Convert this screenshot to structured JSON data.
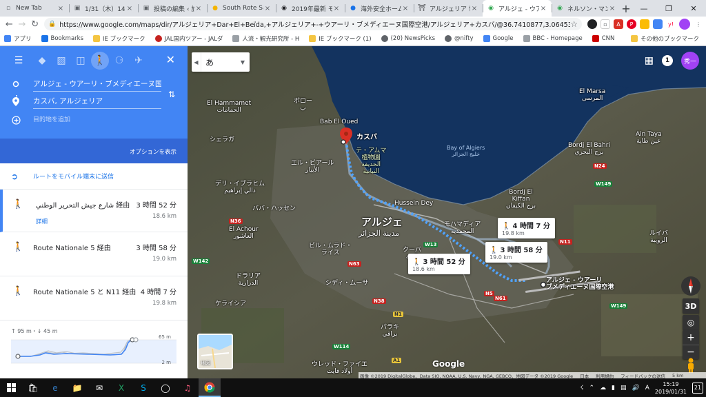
{
  "browser": {
    "tabs": [
      {
        "title": "New Tab",
        "icon": "newtab-icon",
        "color": "#5f6368"
      },
      {
        "title": "1/31（木）14時",
        "icon": "doc-icon",
        "color": "#5f6368"
      },
      {
        "title": "投稿の編集 ‹ 旅行",
        "icon": "doc-icon",
        "color": "#5f6368"
      },
      {
        "title": "South Rote Sa",
        "icon": "site-icon",
        "color": "#f4b400"
      },
      {
        "title": "2019年最新 モ",
        "icon": "tripadvisor-icon",
        "color": "#202124"
      },
      {
        "title": "海外安全ホーム",
        "icon": "site-icon",
        "color": "#1a73e8"
      },
      {
        "title": "アルジェリア 世界",
        "icon": "museum-icon",
        "color": "#202124"
      },
      {
        "title": "アルジェ - ウアーリ",
        "icon": "maps-icon",
        "color": "#34a853"
      },
      {
        "title": "ネルソン・マンデ",
        "icon": "maps-icon",
        "color": "#34a853"
      }
    ],
    "active_tab": 7,
    "url": "https://www.google.com/maps/dir/アルジェリア+Dar+El+Beïda,+アルジェリア+-+ウアーリ・ブメディエーヌ国際空港/アルジェリア+カスバ/@36.7410877,3.0645346,22097m/data=!3m1!1e3!4m14!...",
    "bookmarks": [
      {
        "label": "アプリ",
        "icon": "apps-icon"
      },
      {
        "label": "Bookmarks",
        "icon": "star-icon"
      },
      {
        "label": "IE ブックマーク",
        "icon": "folder-icon"
      },
      {
        "label": "JAL国内ツアー - JALダ",
        "icon": "jal-icon"
      },
      {
        "label": "人流・観光研究所 - H",
        "icon": "doc-icon"
      },
      {
        "label": "IE ブックマーク (1)",
        "icon": "folder-icon"
      },
      {
        "label": "(20) NewsPicks",
        "icon": "site-icon"
      },
      {
        "label": "@nifty",
        "icon": "site-icon"
      },
      {
        "label": "Google",
        "icon": "google-icon"
      },
      {
        "label": "BBC - Homepage",
        "icon": "doc-icon"
      },
      {
        "label": "CNN",
        "icon": "cnn-icon"
      }
    ],
    "other_bookmarks": "その他のブックマーク"
  },
  "panel": {
    "origin": "アルジェ - ウアーリ・ブメディエーヌ国",
    "destination": "カスバ, アルジェリア",
    "add_destination": "目的地を追加",
    "options": "オプションを表示",
    "send_to_phone": "ルートをモバイル端末に送信",
    "routes": [
      {
        "via": "شارع جيش التحرير الوطني 経由",
        "time": "3 時間 52 分",
        "distance": "18.6 km",
        "details": "詳細"
      },
      {
        "via": "Route Nationale 5 経由",
        "time": "3 時間 58 分",
        "distance": "19.0 km"
      },
      {
        "via": "Route Nationale 5 と N11 経由",
        "time": "4 時間 7 分",
        "distance": "19.8 km"
      }
    ],
    "elevation": {
      "up_down": "↑ 95 m・↓ 45 m",
      "max_label": "65 m",
      "min_label": "2 m"
    }
  },
  "map": {
    "ime_char": "あ",
    "notifications": "1",
    "user_initial": "秀一",
    "callouts": [
      {
        "time": "3 時間 52 分",
        "distance": "18.6 km"
      },
      {
        "time": "3 時間 58 分",
        "distance": "19.0 km"
      },
      {
        "time": "4 時間 7 分",
        "distance": "19.8 km"
      }
    ],
    "labels": {
      "kasbah": "カスバ",
      "algiers_jp": "アルジェ",
      "algiers_ar": "مدينة الجزائر",
      "airport": "アルジェ - ウアーリ\nブメディエーヌ国際空港",
      "bay": "Bay of Algiers\nخليج الجزائر",
      "el_hammamet": "El Hammamet\nالحمامات",
      "bab_el_oued": "Bab El Oued",
      "hussein_dey": "Hussein Dey",
      "el_marsa": "El Marsa\nالمرسى",
      "ain_taya": "Ain Taya\nعين طاية",
      "bordj_el_bahri": "Bordj El Bahri\nبرج البحري",
      "bordj_el_kiffan": "Bordj El\nKiffan\nبرج الكيفان",
      "el_achour": "El Achour\nالعاشور",
      "regaya": "ルガイア",
      "gardens": "テ・アムマ\n植物園\nالحديقة\nالنباتية",
      "mohammadia": "モハマディア\nالمحمدية",
      "borouni": "ボロー\nب",
      "bir_mourad": "ビル・ムラド・\nライス",
      "kouba": "クーバ\nالقبة",
      "draria": "ドラリア\nالدرارية",
      "baraki": "バラキ\nبراقي",
      "ouled": "ウレッド・ファイエ\nأولاد فايت",
      "rouiba": "ルイバ\nالرويبة",
      "cheraga": "シェラガ",
      "dely_ibrahim": "デリ・イブラヒム\nدالي إبراهيم",
      "el_biar": "エル・ビアール\nالأبيار",
      "kheraicia": "ケライシア",
      "baba_hassen": "ババ・ハッセン",
      "sidi_moussa": "シディ・ムーサ"
    },
    "shields": [
      "N24",
      "W149",
      "N11",
      "N5",
      "W13",
      "N63",
      "N36",
      "W142",
      "N38",
      "N1",
      "W114",
      "N61",
      "A1",
      "W149"
    ],
    "thumbnail_label": "地図",
    "google_watermark": "Google",
    "attribution": [
      "画像 ©2019 DigitalGlobe、Data SIO, NOAA, U.S. Navy, NGA, GEBCO、地図データ ©2019 Google",
      "日本",
      "利用規約",
      "フィードバックの送信",
      "5 km"
    ],
    "controls": {
      "tilt": "3D"
    }
  },
  "taskbar": {
    "time": "15:19",
    "date": "2019/01/31",
    "badge": "21"
  },
  "colors": {
    "accent": "#4285f4",
    "route": "#4fa3ff",
    "map_bg": "#3d3d33",
    "sea": "#13335f"
  }
}
